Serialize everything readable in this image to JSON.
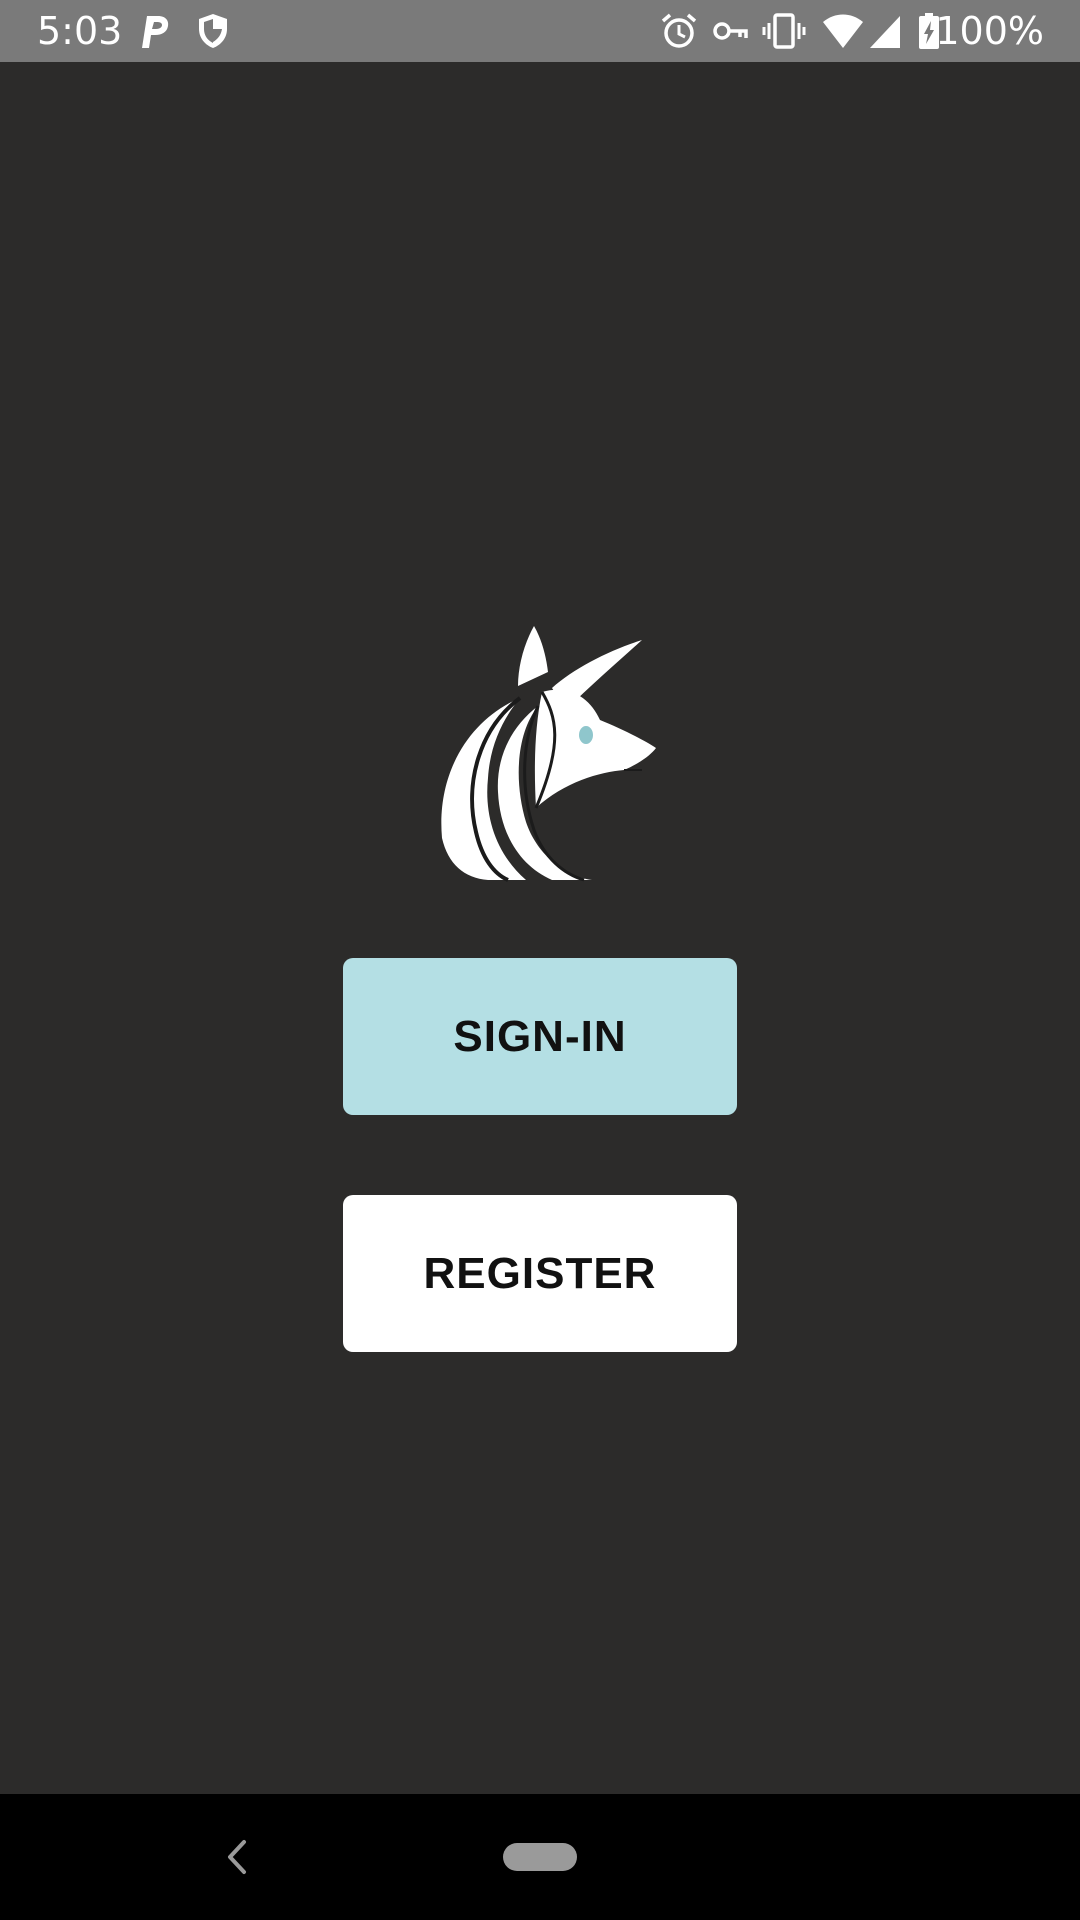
{
  "status_bar": {
    "time": "5:03",
    "battery_text": "100%",
    "icons": [
      "parking-icon",
      "shield-icon",
      "alarm-icon",
      "vpn-key-icon",
      "vibrate-icon",
      "wifi-icon",
      "signal-icon",
      "battery-charging-icon"
    ]
  },
  "main": {
    "logo": "kangaroo-logo",
    "signin_label": "SIGN-IN",
    "register_label": "REGISTER"
  },
  "nav_bar": {
    "icons": [
      "back-icon",
      "home-pill-icon"
    ]
  },
  "colors": {
    "background": "#2c2b2a",
    "status_bar": "#7a7a7a",
    "signin_button": "#b4dfe4",
    "register_button": "#ffffff",
    "nav_bar": "#000000"
  }
}
